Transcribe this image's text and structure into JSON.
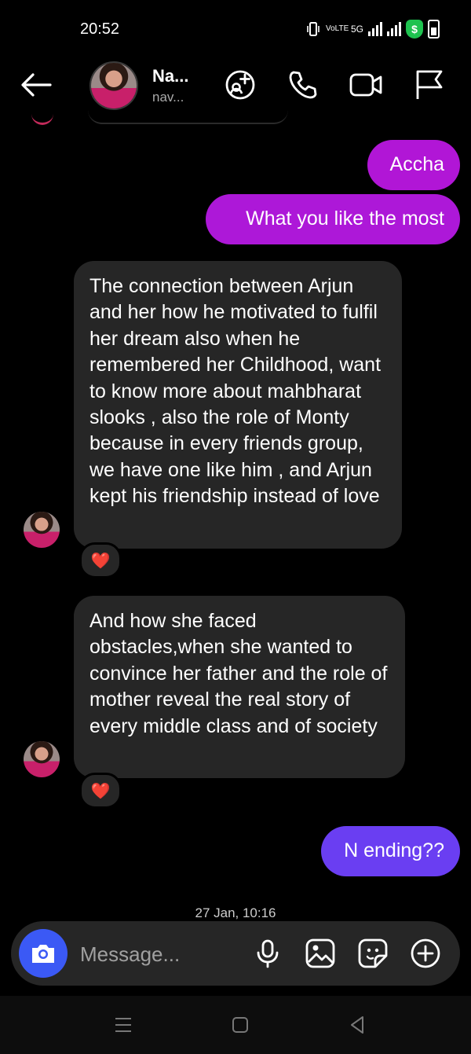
{
  "status_bar": {
    "time": "20:52",
    "volte": "VoLTE",
    "network": "5G",
    "shield_symbol": "$"
  },
  "header": {
    "contact_name": "Na...",
    "contact_username": "nav...",
    "icons": [
      "back-arrow-icon",
      "video-chat-add-icon",
      "phone-icon",
      "video-camera-icon",
      "flag-icon"
    ]
  },
  "messages": {
    "m1": "Accha",
    "m2": "What you like the most",
    "m3": "The connection between Arjun and her how he motivated to fulfil her dream also when he remembered her Childhood, want to know more about mahbharat slooks , also the role of Monty because in every friends group, we have one like him , and Arjun kept his friendship instead of love",
    "m3_reaction": "❤️",
    "m4": "And how she faced obstacles,when she wanted to convince her father and the role of mother reveal the real story of every middle class and of society",
    "m4_reaction": "❤️",
    "m5": "N ending??"
  },
  "timestamp": "27 Jan, 10:16",
  "composer": {
    "placeholder": "Message...",
    "icons": [
      "camera-icon",
      "microphone-icon",
      "gallery-icon",
      "sticker-icon",
      "plus-icon"
    ]
  },
  "colors": {
    "outgoing_magenta": "#b116d6",
    "outgoing_purple": "#6a3ef2",
    "incoming": "#262626",
    "camera_blue": "#3b59f5"
  }
}
